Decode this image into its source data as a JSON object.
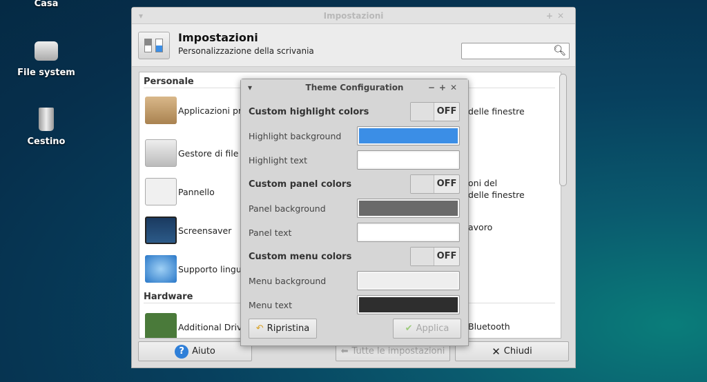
{
  "desktop": {
    "icons": [
      {
        "label": "Casa"
      },
      {
        "label": "File system"
      },
      {
        "label": "Cestino"
      }
    ]
  },
  "window": {
    "title": "Impostazioni",
    "header_title": "Impostazioni",
    "header_subtitle": "Personalizzazione della scrivania",
    "search_placeholder": "",
    "sections": [
      {
        "label": "Personale"
      },
      {
        "label": "Hardware"
      }
    ],
    "items": [
      {
        "label": "Applicazioni pre"
      },
      {
        "label": "Gestore di file"
      },
      {
        "label": "Pannello"
      },
      {
        "label": "Screensaver"
      },
      {
        "label": "Supporto lingu"
      },
      {
        "label": "Additional Drive"
      }
    ],
    "right_items": [
      {
        "label": "delle finestre"
      },
      {
        "label": "oni del"
      },
      {
        "label": "delle finestre"
      },
      {
        "label": "avoro"
      },
      {
        "label": "Bluetooth"
      }
    ],
    "buttons": {
      "help": "Aiuto",
      "all_settings": "Tutte le impostazioni",
      "close": "Chiudi"
    }
  },
  "dialog": {
    "title": "Theme Configuration",
    "rows": [
      {
        "label": "Custom highlight colors",
        "type": "toggle",
        "value": "OFF"
      },
      {
        "label": "Highlight background",
        "type": "color",
        "color": "#3b8ee6"
      },
      {
        "label": "Highlight text",
        "type": "color",
        "color": "#ffffff"
      },
      {
        "label": "Custom panel colors",
        "type": "toggle",
        "value": "OFF"
      },
      {
        "label": "Panel background",
        "type": "color",
        "color": "#6a6a6a"
      },
      {
        "label": "Panel text",
        "type": "color",
        "color": "#ffffff"
      },
      {
        "label": "Custom menu colors",
        "type": "toggle",
        "value": "OFF"
      },
      {
        "label": "Menu background",
        "type": "color",
        "color": "#eeeeee"
      },
      {
        "label": "Menu text",
        "type": "color",
        "color": "#2e2e2e"
      }
    ],
    "reset": "Ripristina",
    "apply": "Applica"
  }
}
